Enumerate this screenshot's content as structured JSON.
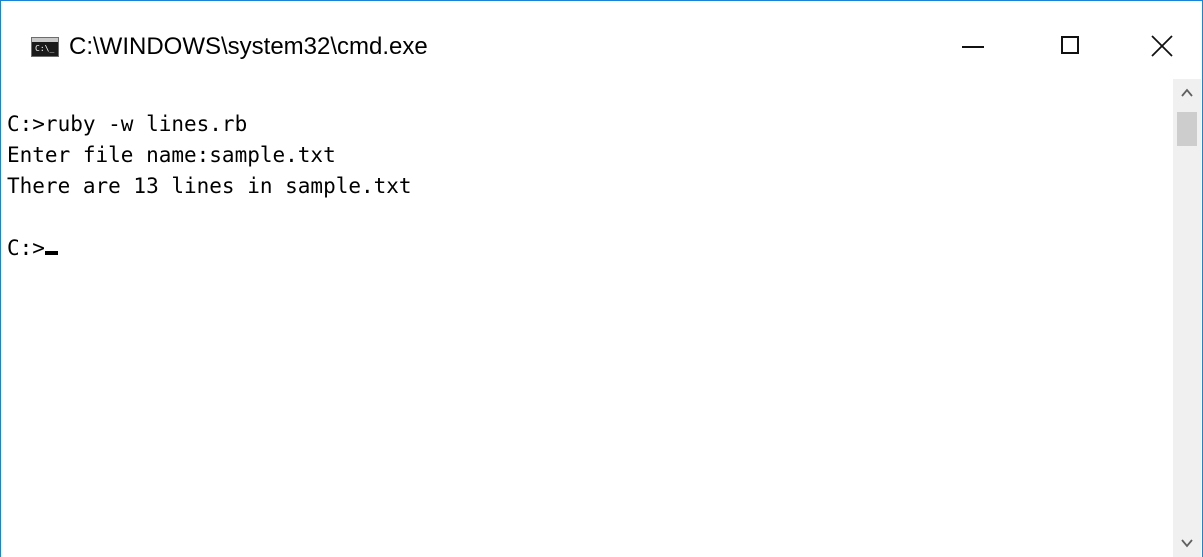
{
  "window": {
    "title": "C:\\WINDOWS\\system32\\cmd.exe",
    "icon": "cmd-icon",
    "icon_text": "C:\\_",
    "controls": {
      "minimize_icon": "minimize-icon",
      "maximize_icon": "maximize-icon",
      "close_icon": "close-icon"
    }
  },
  "console": {
    "lines": [
      "C:>ruby -w lines.rb",
      "Enter file name:sample.txt",
      "There are 13 lines in sample.txt",
      "",
      "C:>"
    ]
  },
  "scrollbar": {
    "up_icon": "chevron-up-icon",
    "down_icon": "chevron-down-icon"
  },
  "colors": {
    "window_border": "#1883d7",
    "background": "#ffffff",
    "text": "#000000",
    "scrollbar_track": "#f0f0f0",
    "scrollbar_thumb": "#cdcdcd"
  }
}
